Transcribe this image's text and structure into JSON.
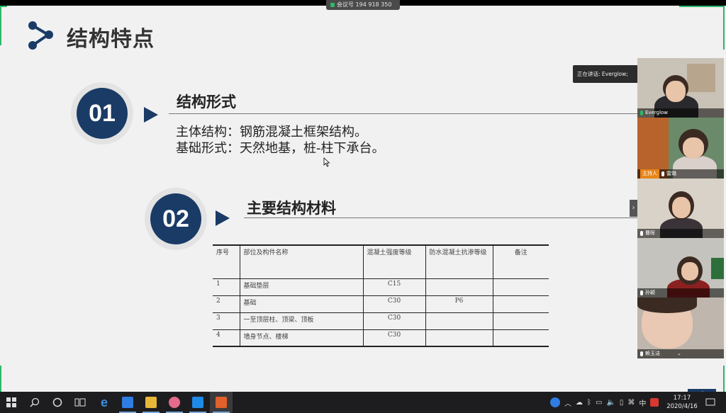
{
  "meeting": {
    "id_label": "会议号 194 918 350",
    "speaking_label": "正在讲话: Everglow;"
  },
  "slide": {
    "title": "结构特点",
    "sections": [
      {
        "number": "01",
        "heading": "结构形式",
        "lines": [
          "主体结构：钢筋混凝土框架结构。",
          "基础形式：天然地基，桩-柱下承台。"
        ]
      },
      {
        "number": "02",
        "heading": "主要结构材料"
      }
    ],
    "table": {
      "headers": [
        "序号",
        "部位及构件名称",
        "混凝土强度等级",
        "防水混凝土抗渗等级",
        "备注"
      ],
      "rows": [
        [
          "1",
          "基础垫层",
          "C15",
          "",
          ""
        ],
        [
          "2",
          "基础",
          "C30",
          "P6",
          ""
        ],
        [
          "3",
          "一至顶层柱、顶梁、顶板",
          "C30",
          "",
          ""
        ],
        [
          "4",
          "墙身节点、楼梯",
          "C30",
          "",
          ""
        ]
      ]
    },
    "page_number": "4"
  },
  "participants": [
    {
      "name": "Everglow",
      "role": ""
    },
    {
      "name": "雷璐",
      "role": "主持人"
    },
    {
      "name": "曹晖",
      "role": ""
    },
    {
      "name": "孙颖",
      "role": ""
    },
    {
      "name": "赖玉洁",
      "role": ""
    }
  ],
  "taskbar": {
    "apps": [
      "windows-start",
      "search",
      "cortana",
      "task-view",
      "edge",
      "tencent-meeting-blue",
      "file-explorer",
      "pink-app",
      "tencent-meeting",
      "powerpoint"
    ],
    "time": "17:17",
    "date": "2020/4/16",
    "ime": "中"
  },
  "colors": {
    "accent_navy": "#1a3b66",
    "accent_green": "#2db86a"
  }
}
